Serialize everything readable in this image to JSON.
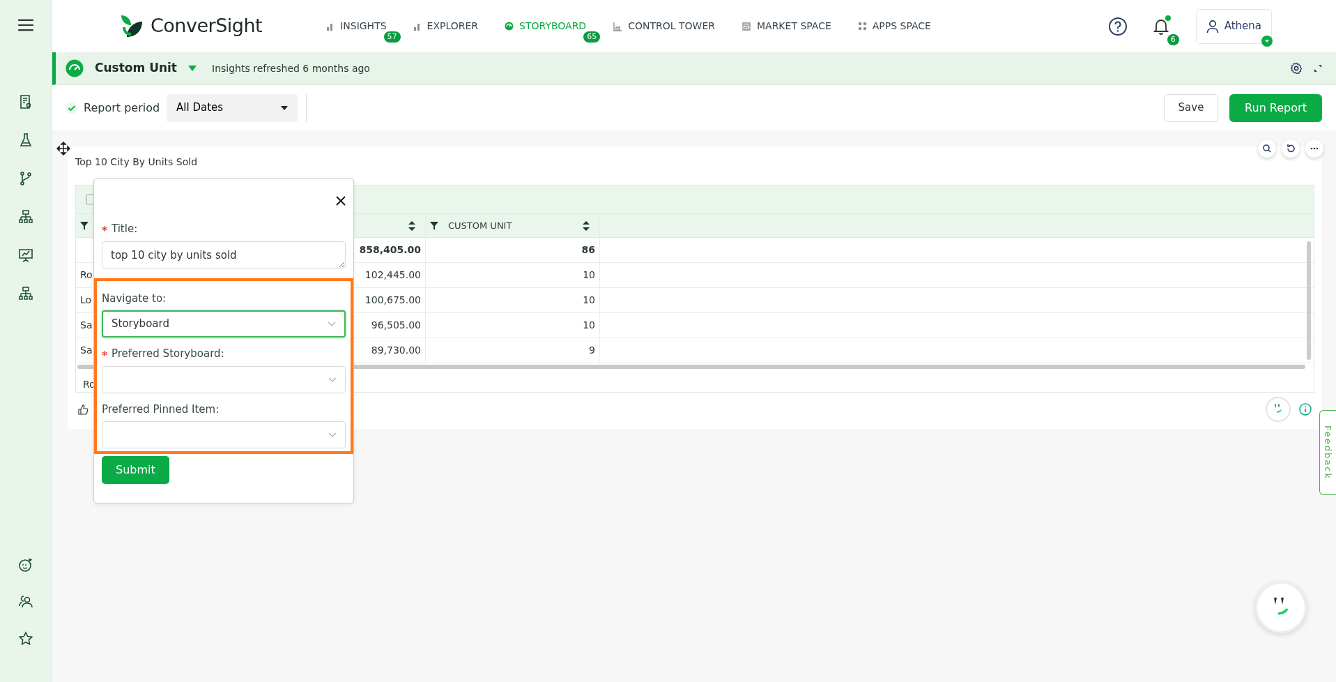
{
  "nav": {
    "logo": "ConverSight",
    "tabs": [
      {
        "label": "INSIGHTS",
        "badge": "57",
        "selected": false
      },
      {
        "label": "EXPLORER",
        "selected": false
      },
      {
        "label": "STORYBOARD",
        "badge": "65",
        "selected": true
      },
      {
        "label": "CONTROL TOWER",
        "selected": false
      },
      {
        "label": "MARKET SPACE",
        "selected": false
      },
      {
        "label": "APPS SPACE",
        "selected": false
      }
    ],
    "notification_count": "6",
    "user": "Athena"
  },
  "report": {
    "title": "Custom Unit",
    "refreshed": "Insights refreshed 6 months ago"
  },
  "toolbar": {
    "report_period": {
      "label": "Report period",
      "checked": true
    },
    "period": "All Dates",
    "buttons": [
      {
        "label": "Save",
        "kind": "outline"
      },
      {
        "label": "Run Report",
        "kind": "primary"
      }
    ]
  },
  "widget": {
    "title": "Top 10 City By Units Sold",
    "table": {
      "columns": [
        {
          "filter": true,
          "sort": false
        },
        {
          "filter": false,
          "sort": true
        },
        {
          "label": "CUSTOM UNIT",
          "filter": true,
          "sort": true
        }
      ],
      "total_row": {
        "column_2": "858,405.00",
        "column_3": "86"
      },
      "rows": [
        {
          "column_1": "Ro",
          "column_2": "102,445.00",
          "column_3": "10"
        },
        {
          "column_1": "Lo",
          "column_2": "100,675.00",
          "column_3": "10"
        },
        {
          "column_1": "Sa",
          "column_2": "96,505.00",
          "column_3": "10"
        },
        {
          "column_1": "Sa",
          "column_2": "89,730.00",
          "column_3": "9"
        }
      ],
      "footer_row": {
        "column_1": "Ro"
      }
    }
  },
  "popup": {
    "title_field": {
      "label": "Title:",
      "required": true,
      "value": "top 10 city by units sold"
    },
    "fields": [
      {
        "label": "Navigate to:",
        "required": false,
        "value": "Storyboard",
        "focused": true
      },
      {
        "label": "Preferred Storyboard:",
        "required": true,
        "focused": false
      },
      {
        "label": "Preferred Pinned Item:",
        "required": false,
        "focused": false
      }
    ],
    "submit": "Submit"
  },
  "feedback": "Feedback"
}
